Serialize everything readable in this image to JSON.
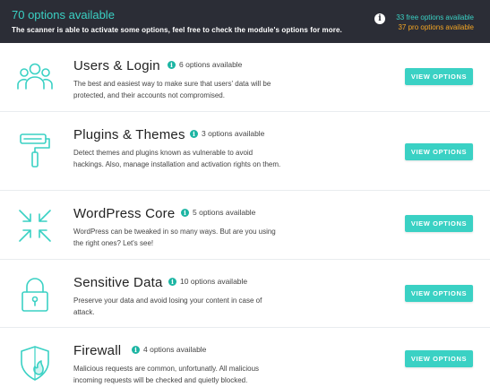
{
  "header": {
    "title": "70 options available",
    "subtitle": "The scanner is able to activate some options, feel free to check the module's options for more.",
    "free_options": "33 free options available",
    "pro_options": "37 pro options available",
    "info_icon": "info-icon"
  },
  "colors": {
    "accent": "#3ad1c4",
    "pro": "#f5a623",
    "header_bg": "#2b2d36",
    "badge": "#1cb5a3"
  },
  "modules": [
    {
      "title": "Users & Login",
      "options": "6 options available",
      "description": "The best and easiest way to make sure that users' data will be protected, and their accounts not compromised.",
      "button": "VIEW OPTIONS",
      "icon": "users-icon"
    },
    {
      "title": "Plugins & Themes",
      "options": "3 options available",
      "description": "Detect themes and plugins known as vulnerable to avoid hackings. Also, manage installation and activation rights on them.",
      "button": "VIEW OPTIONS",
      "icon": "paint-roller-icon"
    },
    {
      "title": "WordPress Core",
      "options": "5 options available",
      "description": "WordPress can be tweaked in so many ways. But are you using the right ones? Let's see!",
      "button": "VIEW OPTIONS",
      "icon": "compress-arrows-icon"
    },
    {
      "title": "Sensitive Data",
      "options": "10 options available",
      "description": "Preserve your data and avoid losing your content in case of attack.",
      "button": "VIEW OPTIONS",
      "icon": "padlock-icon"
    },
    {
      "title": "Firewall",
      "options": "4 options available",
      "description": "Malicious requests are common, unfortunatly. All malicious incoming requests will be checked and quietly blocked.",
      "button": "VIEW OPTIONS",
      "icon": "shield-fire-icon"
    }
  ]
}
